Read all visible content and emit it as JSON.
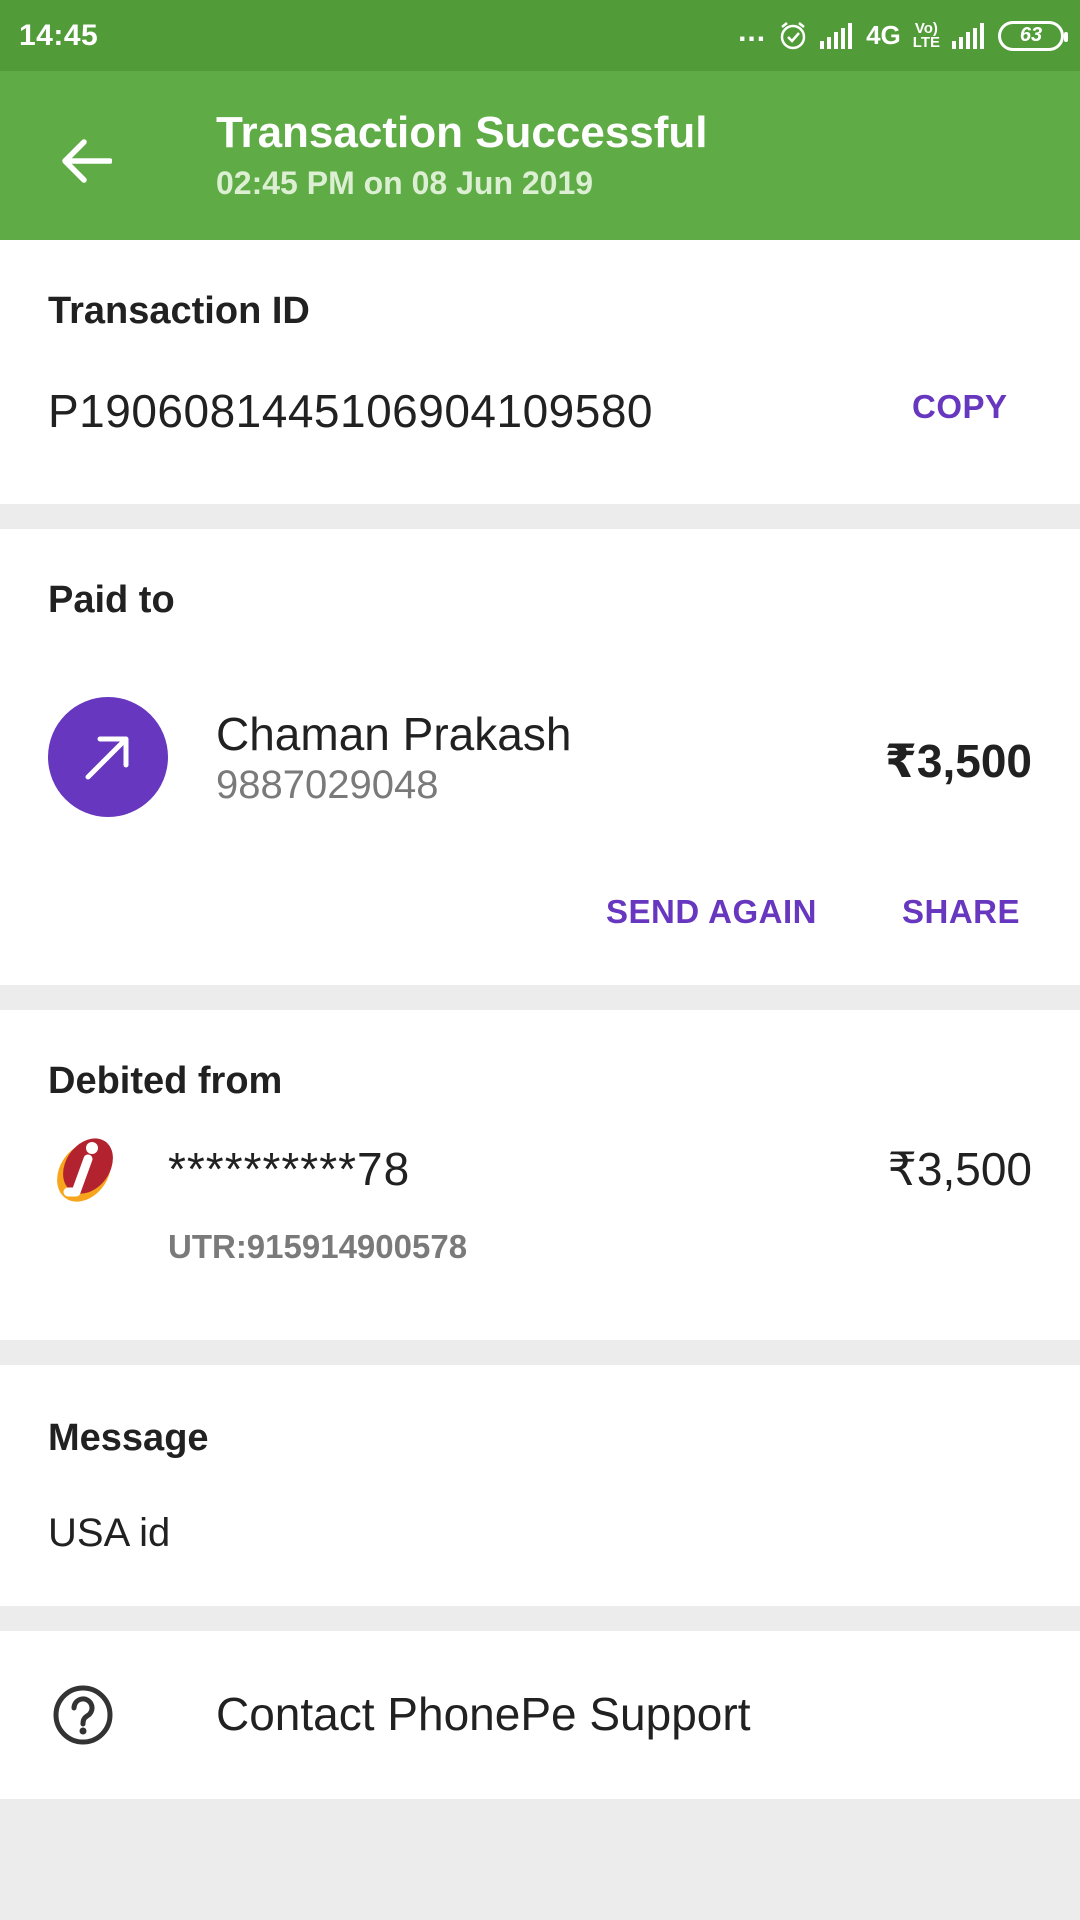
{
  "status_bar": {
    "time": "14:45",
    "dots": "...",
    "network": "4G",
    "volte_top": "Vo)",
    "volte_bottom": "LTE",
    "battery": "63"
  },
  "header": {
    "title": "Transaction Successful",
    "subtitle": "02:45 PM on 08 Jun 2019",
    "back_icon": "arrow-left-icon"
  },
  "transaction": {
    "label": "Transaction ID",
    "id": "P1906081445106904109580",
    "copy_label": "COPY"
  },
  "paid_to": {
    "label": "Paid to",
    "name": "Chaman Prakash",
    "phone": "9887029048",
    "amount": "₹3,500",
    "send_again_label": "SEND AGAIN",
    "share_label": "SHARE",
    "avatar_icon": "arrow-up-right-icon"
  },
  "debited_from": {
    "label": "Debited from",
    "account": "**********78",
    "amount": "₹3,500",
    "utr": "UTR:915914900578",
    "bank_icon": "icici-bank-logo"
  },
  "message": {
    "label": "Message",
    "text": "USA id"
  },
  "support": {
    "label": "Contact PhonePe Support",
    "icon": "help-circle-icon"
  },
  "colors": {
    "status_bar": "#519b38",
    "app_bar": "#5fac47",
    "accent": "#6737bf",
    "background": "#ececec"
  }
}
